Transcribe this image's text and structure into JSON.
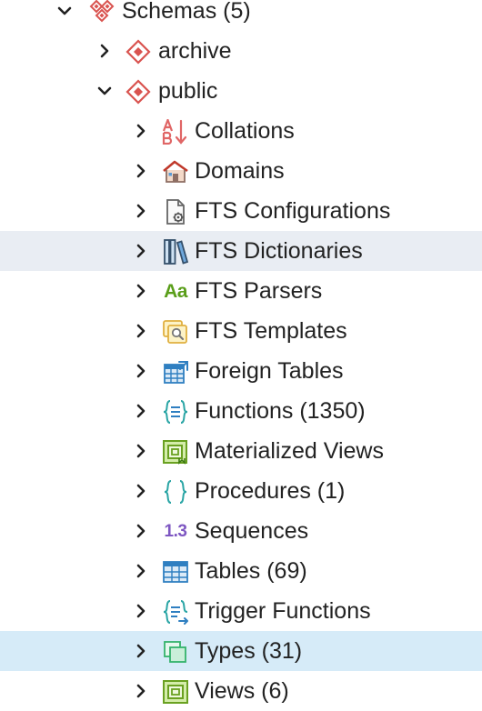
{
  "tree": {
    "schemas": {
      "label": "Schemas (5)",
      "icon": "schemas-icon",
      "expanded": true
    },
    "archive": {
      "label": "archive",
      "icon": "schema-icon",
      "expanded": false
    },
    "public": {
      "label": "public",
      "icon": "schema-icon",
      "expanded": true
    },
    "children": [
      {
        "label": "Collations",
        "icon": "collation-icon"
      },
      {
        "label": "Domains",
        "icon": "domain-icon"
      },
      {
        "label": "FTS Configurations",
        "icon": "fts-configuration-icon"
      },
      {
        "label": "FTS Dictionaries",
        "icon": "fts-dictionary-icon"
      },
      {
        "label": "FTS Parsers",
        "icon": "fts-parser-icon"
      },
      {
        "label": "FTS Templates",
        "icon": "fts-template-icon"
      },
      {
        "label": "Foreign Tables",
        "icon": "foreign-table-icon"
      },
      {
        "label": "Functions (1350)",
        "icon": "function-icon"
      },
      {
        "label": "Materialized Views",
        "icon": "materialized-view-icon"
      },
      {
        "label": "Procedures (1)",
        "icon": "procedure-icon"
      },
      {
        "label": "Sequences",
        "icon": "sequence-icon"
      },
      {
        "label": "Tables (69)",
        "icon": "table-icon"
      },
      {
        "label": "Trigger Functions",
        "icon": "trigger-function-icon"
      },
      {
        "label": "Types (31)",
        "icon": "type-icon"
      },
      {
        "label": "Views (6)",
        "icon": "view-icon"
      }
    ],
    "hover_item": "FTS Dictionaries",
    "selected_item": "Types (31)"
  },
  "icon_glyphs": {
    "fts_parser": "Aa",
    "sequence": "1.3"
  },
  "colors": {
    "hover_background": "#e9edf3",
    "selected_background": "#d6ebf8",
    "schema_red": "#d9534f",
    "chevron": "#222222",
    "text": "#222222"
  }
}
